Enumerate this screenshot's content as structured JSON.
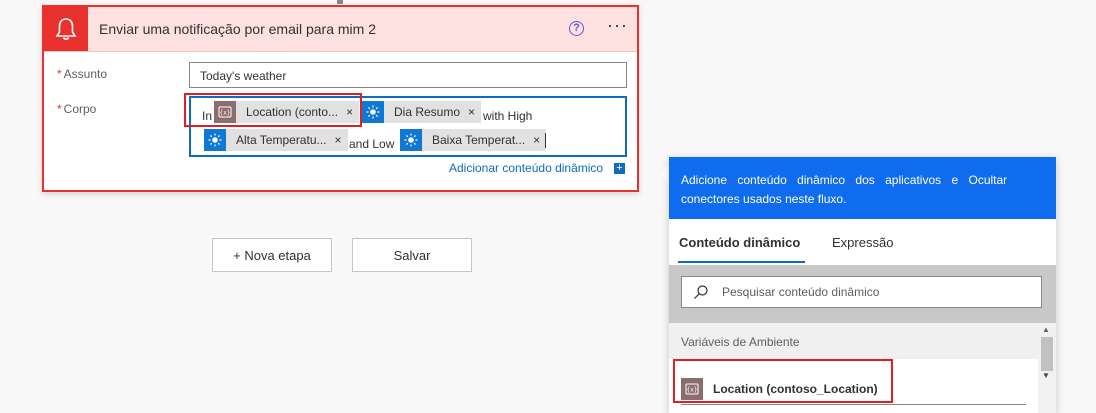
{
  "card": {
    "title": "Enviar uma notificação por email para mim 2",
    "help_glyph": "?",
    "more_glyph": "···",
    "subject_label": "Assunto",
    "body_label": "Corpo",
    "required_mark": "*",
    "subject_value": "Today's weather",
    "body": {
      "text_in": "In",
      "token_location": "Location (conto...",
      "token_day_summary": "Dia Resumo",
      "text_with_high": "with High",
      "token_high_temp": "Alta Temperatu...",
      "text_and_low": "and Low",
      "token_low_temp": "Baixa Temperat...",
      "close_glyph": "×"
    },
    "add_dynamic_content": "Adicionar conteúdo dinâmico",
    "add_dynamic_plus": "+"
  },
  "buttons": {
    "new_step": "+ Nova etapa",
    "save": "Salvar"
  },
  "panel": {
    "description_line1": "Adicione conteúdo dinâmico dos aplicativos e Ocultar",
    "description_line2": "conectores usados neste fluxo.",
    "tabs": [
      "Conteúdo dinâmico",
      "Expressão"
    ],
    "active_tab": "Conteúdo dinâmico",
    "search_placeholder": "Pesquisar conteúdo dinâmico",
    "section_title": "Variáveis de Ambiente",
    "items": [
      {
        "label": "Location (contoso_Location)",
        "icon": "variable-icon"
      }
    ]
  },
  "colors": {
    "accent_red": "#e8312c",
    "header_red_bg": "#fde0e0",
    "link_blue": "#0f6cbd",
    "panel_blue": "#0f6cef",
    "token_location": "#8c6d6d",
    "token_weather": "#0f78d4"
  }
}
